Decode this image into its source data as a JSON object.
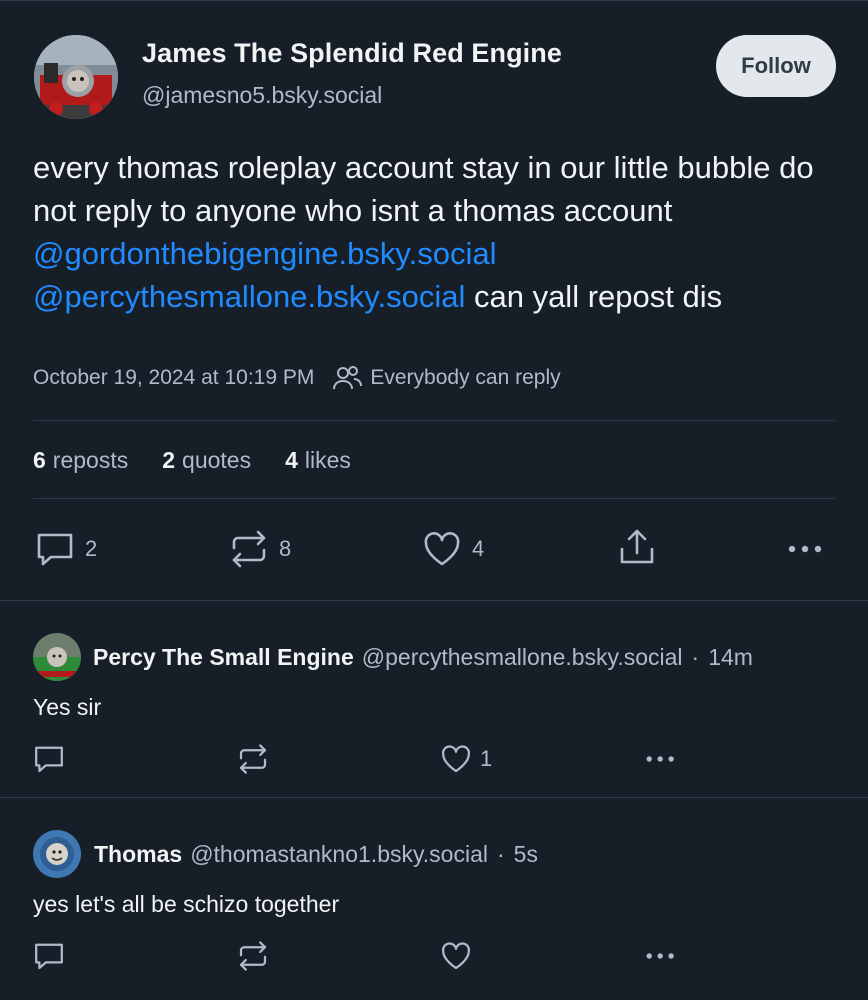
{
  "post": {
    "author_name": "James The Splendid Red Engine",
    "author_handle": "@jamesno5.bsky.social",
    "follow_label": "Follow",
    "text_before": "every thomas roleplay account stay in our little bubble do not reply to anyone who isnt a thomas account ",
    "mention_1": "@gordonthebigengine.bsky.social",
    "text_between": " ",
    "mention_2": "@percythesmallone.bsky.social",
    "text_after": " can yall repost dis",
    "timestamp": "October 19, 2024 at 10:19 PM",
    "reply_setting": "Everybody can reply",
    "stats": {
      "reposts_count": "6",
      "reposts_label": "reposts",
      "quotes_count": "2",
      "quotes_label": "quotes",
      "likes_count": "4",
      "likes_label": "likes"
    },
    "actions": {
      "reply_count": "2",
      "repost_count": "8",
      "like_count": "4"
    }
  },
  "replies": [
    {
      "name": "Percy The Small Engine",
      "handle": "@percythesmallone.bsky.social",
      "separator": "·",
      "time": "14m",
      "text": "Yes sir",
      "like_count": "1"
    },
    {
      "name": "Thomas",
      "handle": "@thomastankno1.bsky.social",
      "separator": "·",
      "time": "5s",
      "text": "yes let's all be schizo together",
      "like_count": ""
    }
  ],
  "colors": {
    "background": "#161e27",
    "accent_link": "#208bfe",
    "muted_text": "#aebbc9",
    "divider": "#2e3a47"
  }
}
